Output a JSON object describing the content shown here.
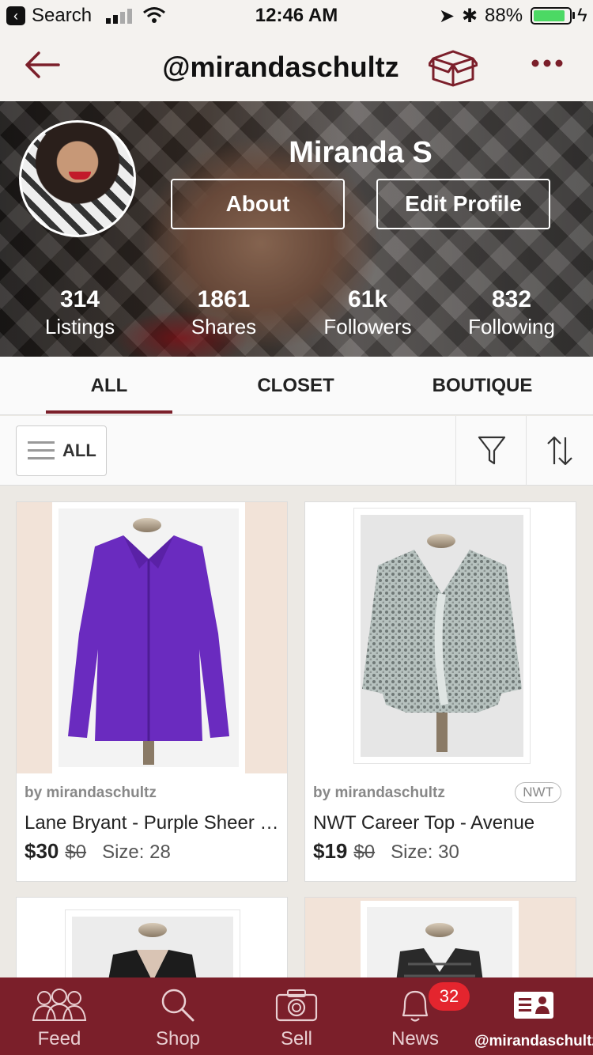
{
  "status_bar": {
    "carrier": "Search",
    "time": "12:46 AM",
    "battery_text": "88%",
    "battery_level": 0.88,
    "battery_color": "#4cd964"
  },
  "nav": {
    "title": "@mirandaschultz",
    "back_icon": "arrow-left-icon",
    "box_icon": "open-box-icon",
    "more_icon": "more-dots-icon",
    "accent_color": "#7b1f2a"
  },
  "profile": {
    "name": "Miranda S",
    "about_label": "About",
    "edit_label": "Edit Profile",
    "stats": [
      {
        "value": "314",
        "label": "Listings"
      },
      {
        "value": "1861",
        "label": "Shares"
      },
      {
        "value": "61k",
        "label": "Followers"
      },
      {
        "value": "832",
        "label": "Following"
      }
    ]
  },
  "tabs": {
    "items": [
      "ALL",
      "CLOSET",
      "BOUTIQUE"
    ],
    "selected": "ALL"
  },
  "filter": {
    "all_label": "ALL",
    "filter_icon": "funnel-icon",
    "sort_icon": "sort-arrows-icon"
  },
  "listings": [
    {
      "by": "by mirandaschultz",
      "title": "Lane Bryant - Purple Sheer Blouse",
      "price": "$30",
      "original_price": "$0",
      "size": "Size: 28",
      "badge": "",
      "color": "#6a2bbf"
    },
    {
      "by": "by mirandaschultz",
      "title": "NWT Career Top - Avenue",
      "price": "$19",
      "original_price": "$0",
      "size": "Size: 30",
      "badge": "NWT",
      "color": "#a9b3b0"
    }
  ],
  "bottom_nav": {
    "items": [
      {
        "label": "Feed",
        "icon": "people-icon"
      },
      {
        "label": "Shop",
        "icon": "search-icon"
      },
      {
        "label": "Sell",
        "icon": "camera-icon"
      },
      {
        "label": "News",
        "icon": "bell-icon"
      },
      {
        "label": "@mirandaschultz",
        "icon": "profile-card-icon"
      }
    ],
    "news_badge": "32",
    "active": "@mirandaschultz"
  }
}
